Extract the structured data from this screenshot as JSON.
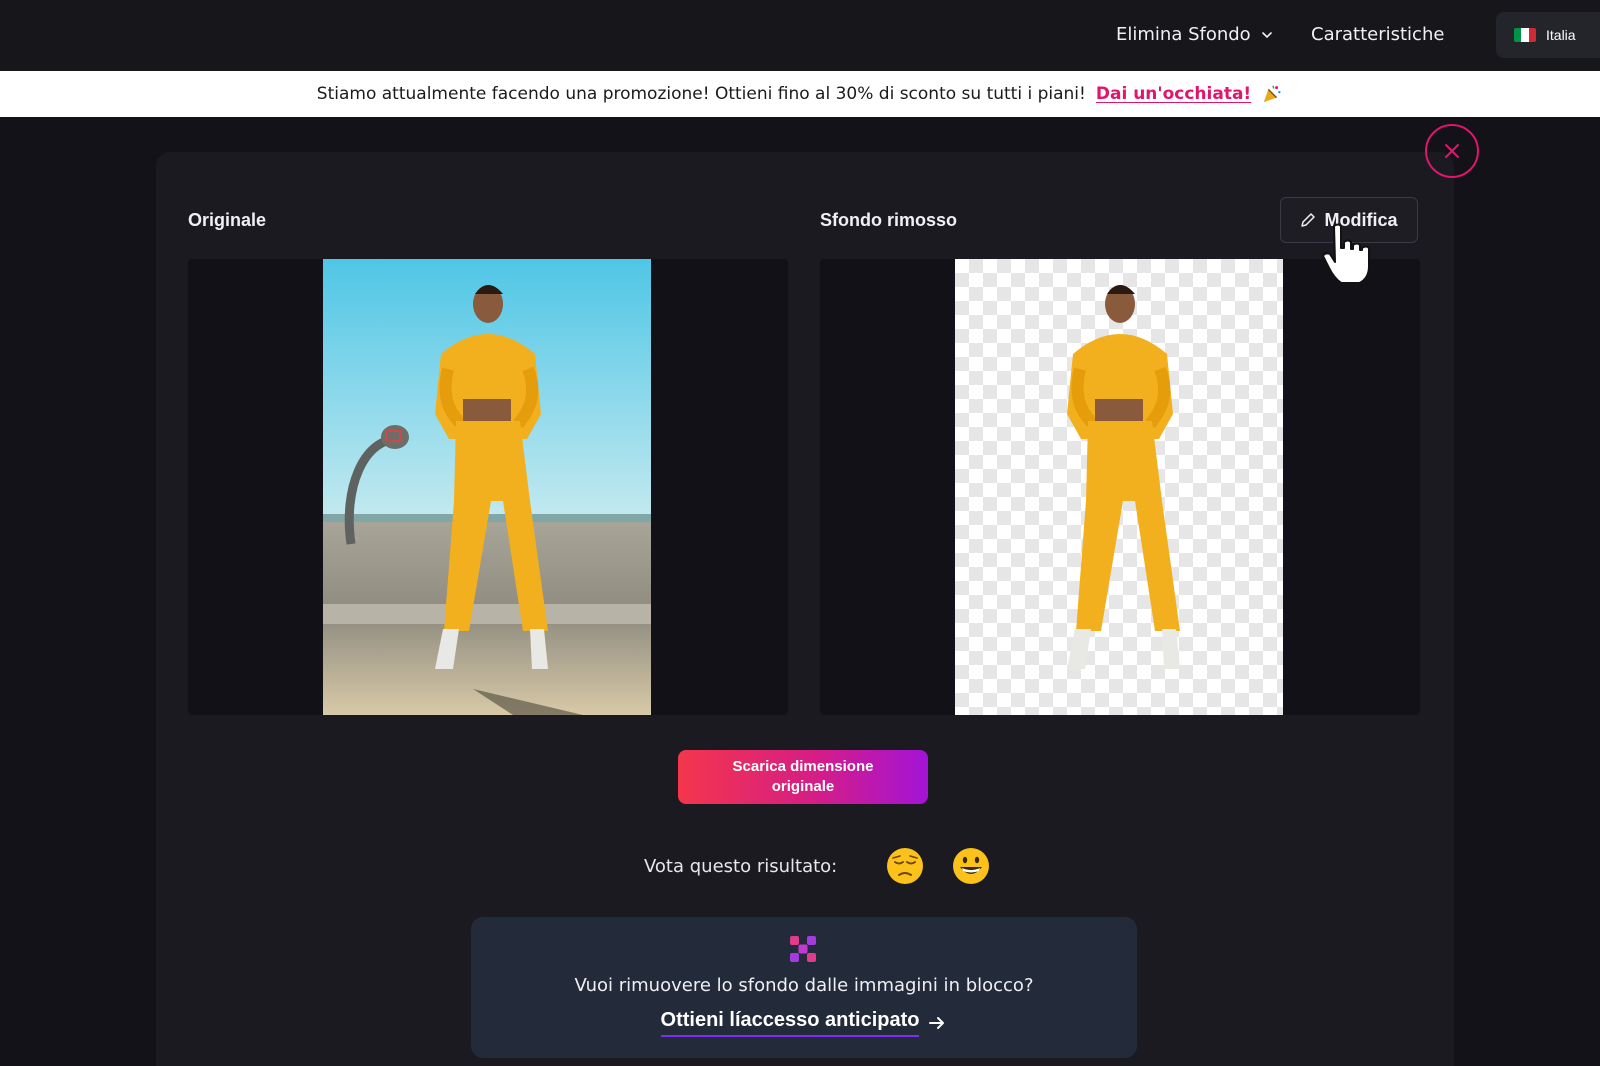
{
  "nav": {
    "remove_bg_label": "Elimina Sfondo",
    "features_label": "Caratteristiche",
    "language_label": "Italia",
    "flag_colors": [
      "#009246",
      "#ffffff",
      "#ce2b37"
    ]
  },
  "promo": {
    "text": "Stiamo attualmente facendo una promozione! Ottieni fino al 30% di sconto su tutti i piani!",
    "link_label": "Dai un'occhiata!",
    "icon": "party-popper-icon"
  },
  "result": {
    "original_title": "Originale",
    "removed_title": "Sfondo rimosso",
    "edit_label": "Modifica",
    "download_label": "Scarica dimensione originale",
    "rate_label": "Vota questo risultato:",
    "rate_options": [
      "pensive-face-icon",
      "grinning-face-icon"
    ]
  },
  "bulk": {
    "question": "Vuoi rimuovere lo sfondo dalle immagini in blocco?",
    "cta_label": "Ottieni líaccesso anticipato"
  },
  "colors": {
    "accent_pink": "#e0156c",
    "gradient_start": "#f4364c",
    "gradient_end": "#a314d6",
    "background": "#121218"
  }
}
